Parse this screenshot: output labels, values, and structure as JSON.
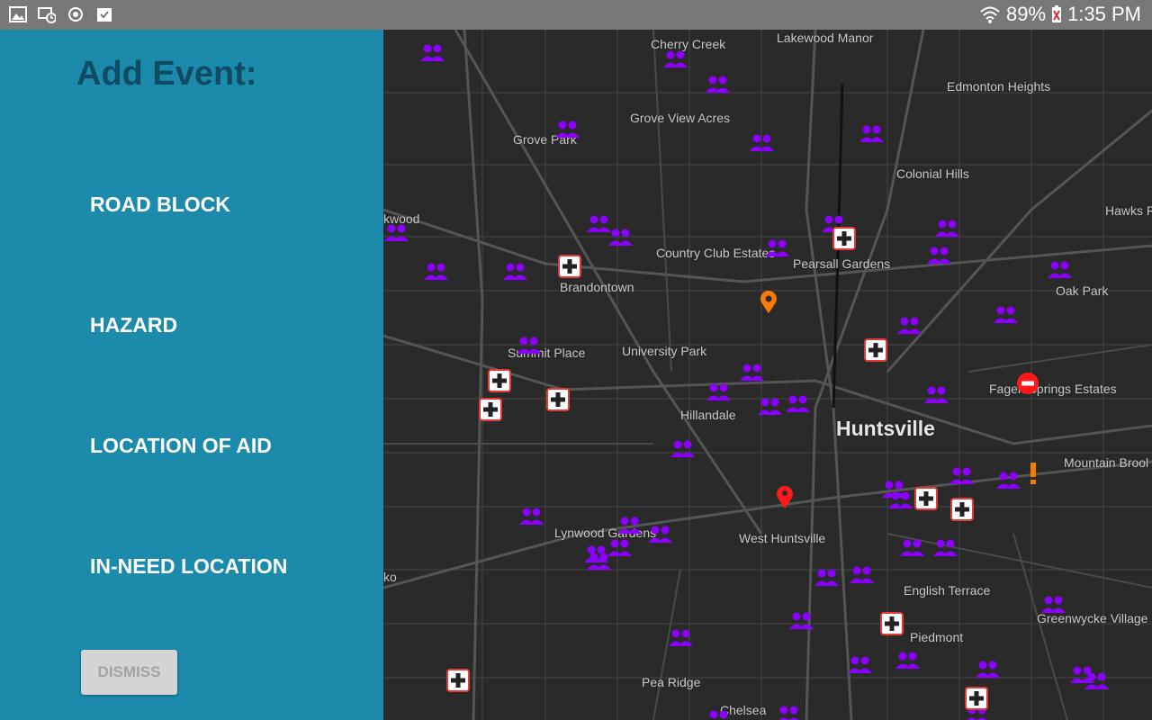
{
  "status_bar": {
    "battery": "89%",
    "time": "1:35 PM",
    "left_icons": [
      "gallery-icon",
      "device-clock-icon",
      "sync-icon",
      "clipboard-check-icon"
    ]
  },
  "panel": {
    "title": "Add Event:",
    "options": [
      "ROAD BLOCK",
      "HAZARD",
      "LOCATION OF AID",
      "IN-NEED LOCATION"
    ],
    "dismiss_label": "DISMISS"
  },
  "map": {
    "places": {
      "cherry_creek": "Cherry Creek",
      "lakewood_manor": "Lakewood Manor",
      "edmonton_heights": "Edmonton Heights",
      "grove_view_acres": "Grove View Acres",
      "grove_park": "Grove Park",
      "colonial_hills": "Colonial Hills",
      "kwood": "kwood",
      "hawks_r": "Hawks R",
      "country_club_estates": "Country Club Estates",
      "pearsall_gardens": "Pearsall Gardens",
      "brandontown": "Brandontown",
      "oak_park": "Oak Park",
      "summit_place": "Summit Place",
      "university_park": "University Park",
      "fagen_springs_estates": "Fagen Springs Estates",
      "hillandale": "Hillandale",
      "huntsville": "Huntsville",
      "mountain_brool": "Mountain Brool",
      "lynwood_gardens": "Lynwood Gardens",
      "west_huntsville": "West Huntsville",
      "ko": "ko",
      "english_terrace": "English Terrace",
      "greenwycke_village": "Greenwycke Village",
      "piedmont": "Piedmont",
      "pea_ridge": "Pea Ridge",
      "chelsea": "Chelsea"
    },
    "colors": {
      "background": "#2a2a2a",
      "road": "#4a4a4a",
      "major_road": "#5a5a5a",
      "in_need": "#8b00ff",
      "aid": "#e53935",
      "hazard": "#f57c00",
      "road_block": "#ff1a1a"
    }
  }
}
